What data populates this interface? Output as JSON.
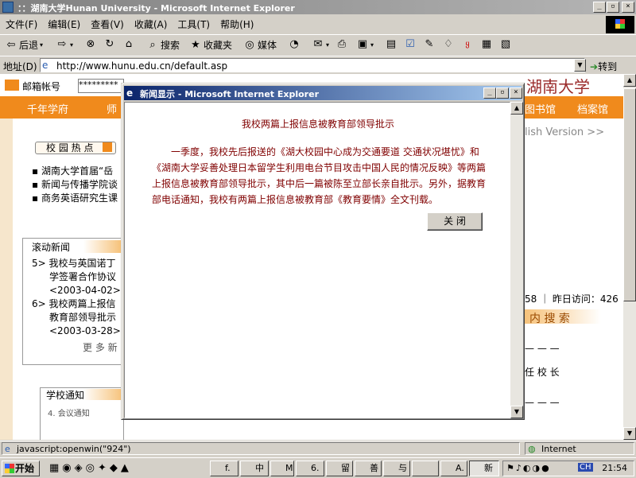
{
  "window": {
    "title": "：：湖南大学Hunan University - Microsoft Internet Explorer"
  },
  "menu": [
    "文件(F)",
    "编辑(E)",
    "查看(V)",
    "收藏(A)",
    "工具(T)",
    "帮助(H)"
  ],
  "toolbar": {
    "back": "后退",
    "search": "搜索",
    "favorites": "收藏夹",
    "media": "媒体"
  },
  "address": {
    "label": "地址(D)",
    "url": "http://www.hunu.edu.cn/default.asp",
    "go": "转到"
  },
  "page": {
    "login_label": "邮箱帐号",
    "password_mask": "*********",
    "nav_items": [
      "千年学府",
      "师",
      "图书馆",
      "档案馆"
    ],
    "english_version": "lish Version >>",
    "logo_text": "湖南大学",
    "hot_title": "校 园 热 点",
    "hot_items": [
      "湖南大学首届“岳",
      "新闻与传播学院谈",
      "商务英语研究生课"
    ],
    "scroll_news_title": "滚动新闻",
    "news": [
      {
        "n": "5>",
        "text1": "我校与英国诺丁",
        "text2": "学签署合作协议",
        "date": "<2003-04-02>"
      },
      {
        "n": "6>",
        "text1": "我校两篇上报信",
        "text2": "教育部领导批示",
        "date": "<2003-03-28>"
      }
    ],
    "more_news": "更 多 新",
    "visit_count": "58 ｜ 昨日访问：426",
    "site_search": "内 搜 索",
    "dashes1": "— — —",
    "principal": "任 校 长",
    "dashes2": "— — —",
    "school_notice": "学校通知",
    "notice_item": "4. 会议通知"
  },
  "dialog": {
    "title": "新闻显示 - Microsoft Internet Explorer",
    "headline": "我校两篇上报信息被教育部领导批示",
    "body": "一季度，我校先后报送的《湖大校园中心成为交通要道 交通状况堪忧》和《湖南大学妥善处理日本留学生利用电台节目攻击中国人民的情况反映》等两篇上报信息被教育部领导批示，其中后一篇被陈至立部长亲自批示。另外，据教育部电话通知，我校有两篇上报信息被教育部《教育要情》全文刊载。",
    "close_label": "关 闭"
  },
  "status": {
    "text": "javascript:openwin(\"924\")",
    "zone": "Internet"
  },
  "taskbar": {
    "start": "开始",
    "tasks": [
      "f.",
      "中",
      "M",
      "6.",
      "留",
      "善",
      "与",
      "",
      "A.",
      "新"
    ],
    "clock": "21:54",
    "ime": "CH"
  },
  "colors": {
    "accent_orange": "#f08a1c",
    "dialog_text": "#800000",
    "dialog_title": "#0a246a"
  },
  "icons": [
    "ie-icon",
    "back-arrow-icon",
    "forward-arrow-icon",
    "stop-icon",
    "refresh-icon",
    "home-icon",
    "search-icon",
    "favorites-icon",
    "media-icon",
    "history-icon",
    "mail-icon",
    "print-icon",
    "windows-logo-icon"
  ]
}
